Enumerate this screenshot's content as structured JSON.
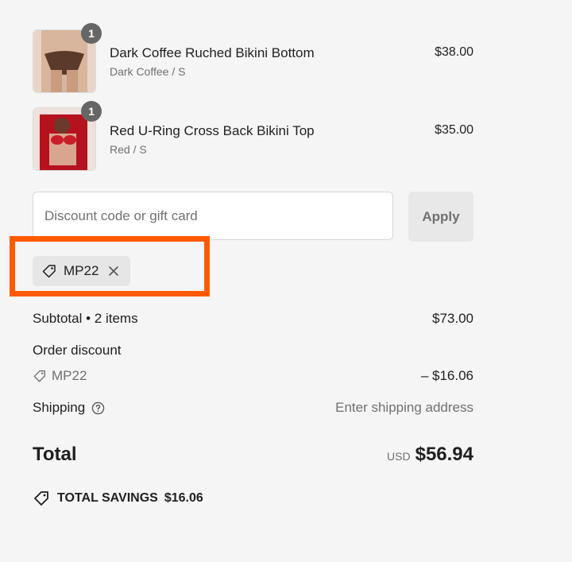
{
  "items": [
    {
      "title": "Dark Coffee Ruched Bikini Bottom",
      "variant": "Dark Coffee / S",
      "price": "$38.00",
      "quantity": "1"
    },
    {
      "title": "Red U-Ring Cross Back Bikini Top",
      "variant": "Red / S",
      "price": "$35.00",
      "quantity": "1"
    }
  ],
  "discount": {
    "placeholder": "Discount code or gift card",
    "apply_label": "Apply",
    "applied_code": "MP22"
  },
  "summary": {
    "subtotal_label": "Subtotal • 2 items",
    "subtotal_value": "$73.00",
    "order_discount_label": "Order discount",
    "order_discount_code": "MP22",
    "order_discount_value": "– $16.06",
    "shipping_label": "Shipping",
    "shipping_value": "Enter shipping address",
    "total_label": "Total",
    "currency": "USD",
    "total_value": "$56.94",
    "savings_label": "TOTAL SAVINGS",
    "savings_value": "$16.06"
  },
  "colors": {
    "highlight": "#ff5a00",
    "badge": "#666666",
    "bottom_swatch": "#5a3a2a",
    "top_swatch": "#c91e2a"
  },
  "icons": [
    "tag-icon",
    "close-icon",
    "help-circle-icon",
    "savings-tag-icon"
  ]
}
